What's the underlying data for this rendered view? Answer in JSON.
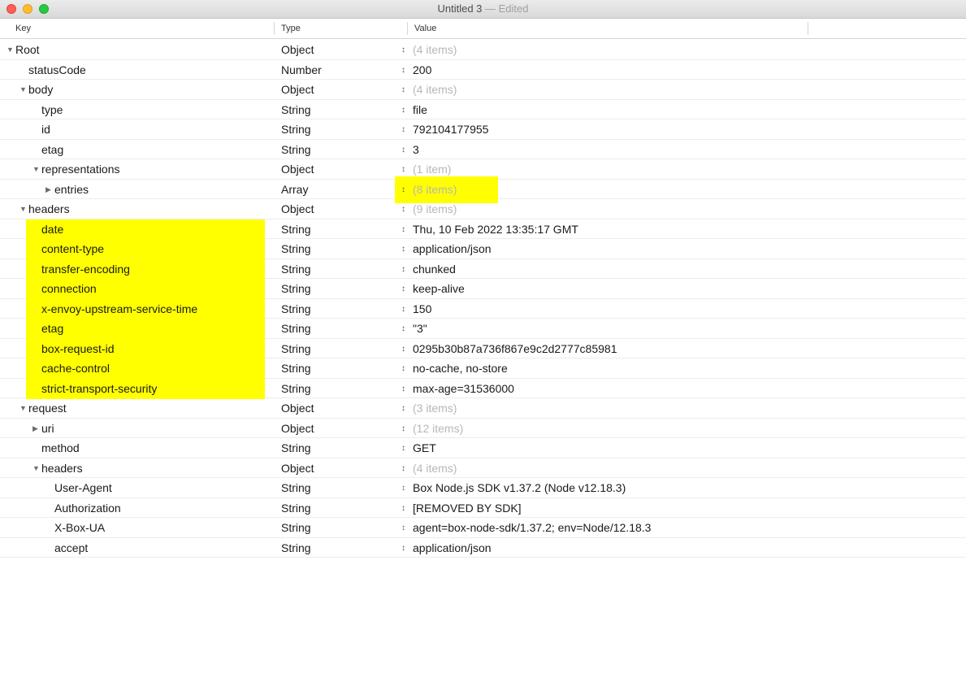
{
  "window": {
    "title": "Untitled 3",
    "separator": "—",
    "status": "Edited"
  },
  "columns": {
    "key": "Key",
    "type": "Type",
    "value": "Value"
  },
  "colors": {
    "highlight": "#ffff00",
    "muted_text": "#b7b7b7"
  },
  "rows": [
    {
      "key": "Root",
      "type": "Object",
      "value": "(4 items)",
      "level": 0,
      "disclosure": "expanded",
      "muted": true
    },
    {
      "key": "statusCode",
      "type": "Number",
      "value": "200",
      "level": 1,
      "disclosure": "none"
    },
    {
      "key": "body",
      "type": "Object",
      "value": "(4 items)",
      "level": 1,
      "disclosure": "expanded",
      "muted": true
    },
    {
      "key": "type",
      "type": "String",
      "value": "file",
      "level": 2,
      "disclosure": "none"
    },
    {
      "key": "id",
      "type": "String",
      "value": "792104177955",
      "level": 2,
      "disclosure": "none"
    },
    {
      "key": "etag",
      "type": "String",
      "value": "3",
      "level": 2,
      "disclosure": "none"
    },
    {
      "key": "representations",
      "type": "Object",
      "value": "(1 item)",
      "level": 2,
      "disclosure": "expanded",
      "muted": true
    },
    {
      "key": "entries",
      "type": "Array",
      "value": "(8 items)",
      "level": 3,
      "disclosure": "collapsed",
      "muted": true,
      "value_highlighted": true
    },
    {
      "key": "headers",
      "type": "Object",
      "value": "(9 items)",
      "level": 1,
      "disclosure": "expanded",
      "muted": true
    },
    {
      "key": "date",
      "type": "String",
      "value": "Thu, 10 Feb 2022 13:35:17 GMT",
      "level": 2,
      "disclosure": "none",
      "key_highlighted": true
    },
    {
      "key": "content-type",
      "type": "String",
      "value": "application/json",
      "level": 2,
      "disclosure": "none",
      "key_highlighted": true
    },
    {
      "key": "transfer-encoding",
      "type": "String",
      "value": "chunked",
      "level": 2,
      "disclosure": "none",
      "key_highlighted": true
    },
    {
      "key": "connection",
      "type": "String",
      "value": "keep-alive",
      "level": 2,
      "disclosure": "none",
      "key_highlighted": true
    },
    {
      "key": "x-envoy-upstream-service-time",
      "type": "String",
      "value": "150",
      "level": 2,
      "disclosure": "none",
      "key_highlighted": true
    },
    {
      "key": "etag",
      "type": "String",
      "value": "\"3\"",
      "level": 2,
      "disclosure": "none",
      "key_highlighted": true
    },
    {
      "key": "box-request-id",
      "type": "String",
      "value": "0295b30b87a736f867e9c2d2777c85981",
      "level": 2,
      "disclosure": "none",
      "key_highlighted": true
    },
    {
      "key": "cache-control",
      "type": "String",
      "value": "no-cache, no-store",
      "level": 2,
      "disclosure": "none",
      "key_highlighted": true
    },
    {
      "key": "strict-transport-security",
      "type": "String",
      "value": "max-age=31536000",
      "level": 2,
      "disclosure": "none",
      "key_highlighted": true
    },
    {
      "key": "request",
      "type": "Object",
      "value": "(3 items)",
      "level": 1,
      "disclosure": "expanded",
      "muted": true
    },
    {
      "key": "uri",
      "type": "Object",
      "value": "(12 items)",
      "level": 2,
      "disclosure": "collapsed",
      "muted": true
    },
    {
      "key": "method",
      "type": "String",
      "value": "GET",
      "level": 2,
      "disclosure": "none"
    },
    {
      "key": "headers",
      "type": "Object",
      "value": "(4 items)",
      "level": 2,
      "disclosure": "expanded",
      "muted": true
    },
    {
      "key": "User-Agent",
      "type": "String",
      "value": "Box Node.js SDK v1.37.2 (Node v12.18.3)",
      "level": 3,
      "disclosure": "none"
    },
    {
      "key": "Authorization",
      "type": "String",
      "value": "[REMOVED BY SDK]",
      "level": 3,
      "disclosure": "none"
    },
    {
      "key": "X-Box-UA",
      "type": "String",
      "value": "agent=box-node-sdk/1.37.2; env=Node/12.18.3",
      "level": 3,
      "disclosure": "none"
    },
    {
      "key": "accept",
      "type": "String",
      "value": "application/json",
      "level": 3,
      "disclosure": "none"
    }
  ]
}
